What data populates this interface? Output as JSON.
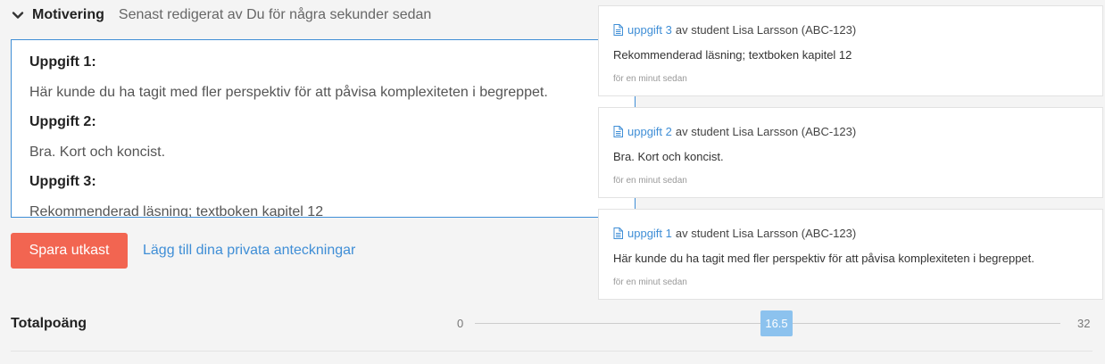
{
  "header": {
    "title": "Motivering",
    "subtitle": "Senast redigerat av Du för några sekunder sedan"
  },
  "editor": {
    "blocks": [
      {
        "heading": "Uppgift 1:",
        "text": "Här kunde du ha tagit med fler perspektiv för att påvisa komplexiteten i begreppet."
      },
      {
        "heading": "Uppgift 2:",
        "text": "Bra. Kort och koncist."
      },
      {
        "heading": "Uppgift 3:",
        "text": "Rekommenderad läsning; textboken kapitel 12"
      }
    ]
  },
  "actions": {
    "save_label": "Spara utkast",
    "notes_link": "Lägg till dina privata anteckningar"
  },
  "total": {
    "label": "Totalpoäng",
    "min": "0",
    "value": "16.5",
    "max": "32"
  },
  "comments": [
    {
      "link": "uppgift 3",
      "meta": "av student Lisa Larsson (ABC-123)",
      "text": "Rekommenderad läsning; textboken kapitel 12",
      "time": "för en minut sedan"
    },
    {
      "link": "uppgift 2",
      "meta": "av student Lisa Larsson (ABC-123)",
      "text": "Bra. Kort och koncist.",
      "time": "för en minut sedan"
    },
    {
      "link": "uppgift 1",
      "meta": "av student Lisa Larsson (ABC-123)",
      "text": "Här kunde du ha tagit med fler perspektiv för att påvisa komplexiteten i begreppet.",
      "time": "för en minut sedan"
    }
  ],
  "colors": {
    "accent": "#3f8ed6",
    "save_button": "#f26551",
    "slider_handle": "#8cc2ee"
  },
  "icons": {
    "collapse": "chevron-down-icon",
    "comment_doc": "document-icon"
  }
}
